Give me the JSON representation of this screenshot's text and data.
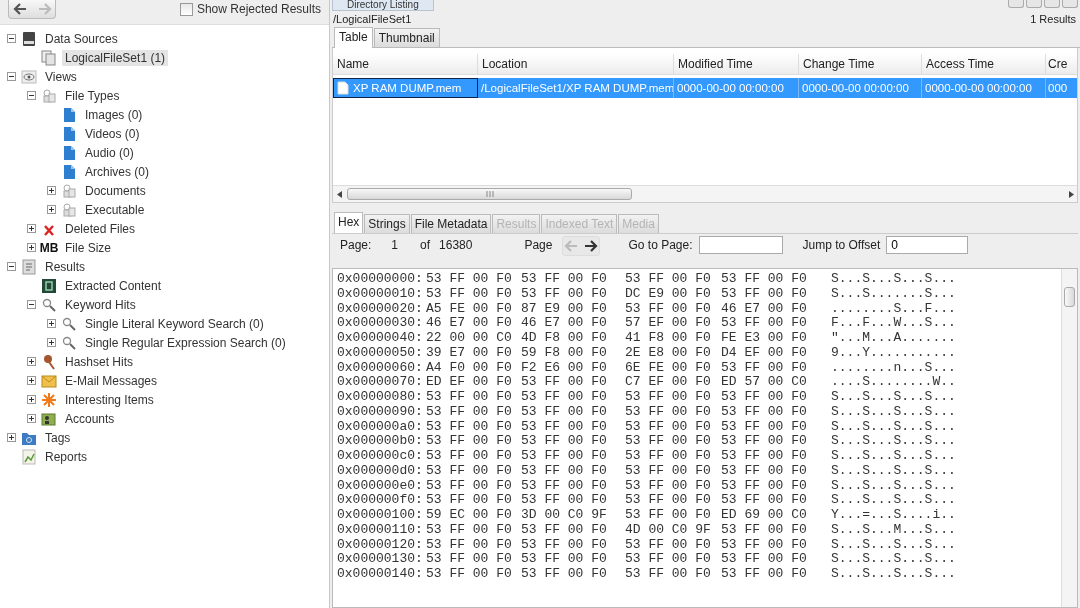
{
  "toolbar": {
    "nav_buttons": [
      {
        "kind": "back",
        "disabled": false
      },
      {
        "kind": "forward",
        "disabled": true
      }
    ],
    "show_rejected": {
      "label": "Show Rejected Results",
      "checked": false
    }
  },
  "tree": [
    {
      "label": "Data Sources",
      "kind": "drive",
      "expanded": true,
      "selected": false,
      "children": [
        {
          "label": "LogicalFileSet1 (1)",
          "kind": "files",
          "selected": true
        }
      ]
    },
    {
      "label": "Views",
      "kind": "eye",
      "expanded": true,
      "selected": false,
      "children": [
        {
          "label": "File Types",
          "kind": "filetypes",
          "expanded": true,
          "selected": false,
          "children": [
            {
              "label": "Images (0)",
              "kind": "doc",
              "selected": false
            },
            {
              "label": "Videos (0)",
              "kind": "doc",
              "selected": false
            },
            {
              "label": "Audio (0)",
              "kind": "doc",
              "selected": false
            },
            {
              "label": "Archives (0)",
              "kind": "doc",
              "selected": false
            },
            {
              "label": "Documents",
              "kind": "filetypes",
              "expanded": false,
              "selected": false
            },
            {
              "label": "Executable",
              "kind": "filetypes",
              "expanded": false,
              "selected": false
            }
          ]
        },
        {
          "label": "Deleted Files",
          "kind": "deleted",
          "expanded": false,
          "selected": false
        },
        {
          "label": "File Size",
          "kind": "size",
          "icon_text": "MB",
          "expanded": false,
          "selected": false
        }
      ]
    },
    {
      "label": "Results",
      "kind": "results",
      "expanded": true,
      "selected": false,
      "children": [
        {
          "label": "Extracted Content",
          "kind": "extracted",
          "selected": false
        },
        {
          "label": "Keyword Hits",
          "kind": "search",
          "expanded": true,
          "selected": false,
          "children": [
            {
              "label": "Single Literal Keyword Search (0)",
              "kind": "search",
              "expanded": false,
              "selected": false
            },
            {
              "label": "Single Regular Expression Search (0)",
              "kind": "search",
              "expanded": false,
              "selected": false
            }
          ]
        },
        {
          "label": "Hashset Hits",
          "kind": "pin",
          "expanded": false,
          "selected": false
        },
        {
          "label": "E-Mail Messages",
          "kind": "mail",
          "expanded": false,
          "selected": false
        },
        {
          "label": "Interesting Items",
          "kind": "star",
          "expanded": false,
          "selected": false
        },
        {
          "label": "Accounts",
          "kind": "accounts",
          "expanded": false,
          "selected": false
        }
      ]
    },
    {
      "label": "Tags",
      "kind": "tags",
      "expanded": false,
      "selected": false
    },
    {
      "label": "Reports",
      "kind": "reports",
      "selected": false
    }
  ],
  "listing": {
    "tab": "Directory Listing",
    "path": "/LogicalFileSet1",
    "result_count": "1 Results",
    "tabs": [
      {
        "label": "Table",
        "selected": true
      },
      {
        "label": "Thumbnail",
        "selected": false
      }
    ],
    "columns": [
      "Name",
      "Location",
      "Modified Time",
      "Change Time",
      "Access Time",
      "Cre"
    ],
    "rows": [
      {
        "cells": [
          "XP RAM DUMP.mem",
          "/LogicalFileSet1/XP RAM DUMP.mem",
          "0000-00-00 00:00:00",
          "0000-00-00 00:00:00",
          "0000-00-00 00:00:00",
          "000"
        ],
        "selected": true
      }
    ]
  },
  "viewer": {
    "tabs": [
      {
        "label": "Hex",
        "selected": true,
        "disabled": false
      },
      {
        "label": "Strings",
        "selected": false,
        "disabled": false
      },
      {
        "label": "File Metadata",
        "selected": false,
        "disabled": false
      },
      {
        "label": "Results",
        "selected": false,
        "disabled": true
      },
      {
        "label": "Indexed Text",
        "selected": false,
        "disabled": true
      },
      {
        "label": "Media",
        "selected": false,
        "disabled": true
      }
    ],
    "pager": {
      "page_label": "Page:",
      "page": "1",
      "of_label": "of",
      "total": "16380",
      "nav_label": "Page",
      "nav_buttons": [
        {
          "kind": "prev",
          "disabled": true
        },
        {
          "kind": "next",
          "disabled": false
        }
      ],
      "goto_label": "Go to Page:",
      "jump_label": "Jump to Offset",
      "jump_value": "0"
    },
    "hex_rows": [
      {
        "offset": "0x00000000:",
        "groups": [
          "53 FF 00 F0",
          "53 FF 00 F0",
          "53 FF 00 F0",
          "53 FF 00 F0"
        ],
        "ascii": "S...S...S...S..."
      },
      {
        "offset": "0x00000010:",
        "groups": [
          "53 FF 00 F0",
          "53 FF 00 F0",
          "DC E9 00 F0",
          "53 FF 00 F0"
        ],
        "ascii": "S...S.......S..."
      },
      {
        "offset": "0x00000020:",
        "groups": [
          "A5 FE 00 F0",
          "87 E9 00 F0",
          "53 FF 00 F0",
          "46 E7 00 F0"
        ],
        "ascii": "........S...F..."
      },
      {
        "offset": "0x00000030:",
        "groups": [
          "46 E7 00 F0",
          "46 E7 00 F0",
          "57 EF 00 F0",
          "53 FF 00 F0"
        ],
        "ascii": "F...F...W...S..."
      },
      {
        "offset": "0x00000040:",
        "groups": [
          "22 00 00 C0",
          "4D F8 00 F0",
          "41 F8 00 F0",
          "FE E3 00 F0"
        ],
        "ascii": "\"...M...A......."
      },
      {
        "offset": "0x00000050:",
        "groups": [
          "39 E7 00 F0",
          "59 F8 00 F0",
          "2E E8 00 F0",
          "D4 EF 00 F0"
        ],
        "ascii": "9...Y..........."
      },
      {
        "offset": "0x00000060:",
        "groups": [
          "A4 F0 00 F0",
          "F2 E6 00 F0",
          "6E FE 00 F0",
          "53 FF 00 F0"
        ],
        "ascii": "........n...S..."
      },
      {
        "offset": "0x00000070:",
        "groups": [
          "ED EF 00 F0",
          "53 FF 00 F0",
          "C7 EF 00 F0",
          "ED 57 00 C0"
        ],
        "ascii": "....S........W.."
      },
      {
        "offset": "0x00000080:",
        "groups": [
          "53 FF 00 F0",
          "53 FF 00 F0",
          "53 FF 00 F0",
          "53 FF 00 F0"
        ],
        "ascii": "S...S...S...S..."
      },
      {
        "offset": "0x00000090:",
        "groups": [
          "53 FF 00 F0",
          "53 FF 00 F0",
          "53 FF 00 F0",
          "53 FF 00 F0"
        ],
        "ascii": "S...S...S...S..."
      },
      {
        "offset": "0x000000a0:",
        "groups": [
          "53 FF 00 F0",
          "53 FF 00 F0",
          "53 FF 00 F0",
          "53 FF 00 F0"
        ],
        "ascii": "S...S...S...S..."
      },
      {
        "offset": "0x000000b0:",
        "groups": [
          "53 FF 00 F0",
          "53 FF 00 F0",
          "53 FF 00 F0",
          "53 FF 00 F0"
        ],
        "ascii": "S...S...S...S..."
      },
      {
        "offset": "0x000000c0:",
        "groups": [
          "53 FF 00 F0",
          "53 FF 00 F0",
          "53 FF 00 F0",
          "53 FF 00 F0"
        ],
        "ascii": "S...S...S...S..."
      },
      {
        "offset": "0x000000d0:",
        "groups": [
          "53 FF 00 F0",
          "53 FF 00 F0",
          "53 FF 00 F0",
          "53 FF 00 F0"
        ],
        "ascii": "S...S...S...S..."
      },
      {
        "offset": "0x000000e0:",
        "groups": [
          "53 FF 00 F0",
          "53 FF 00 F0",
          "53 FF 00 F0",
          "53 FF 00 F0"
        ],
        "ascii": "S...S...S...S..."
      },
      {
        "offset": "0x000000f0:",
        "groups": [
          "53 FF 00 F0",
          "53 FF 00 F0",
          "53 FF 00 F0",
          "53 FF 00 F0"
        ],
        "ascii": "S...S...S...S..."
      },
      {
        "offset": "0x00000100:",
        "groups": [
          "59 EC 00 F0",
          "3D 00 C0 9F",
          "53 FF 00 F0",
          "ED 69 00 C0"
        ],
        "ascii": "Y...=...S....i.."
      },
      {
        "offset": "0x00000110:",
        "groups": [
          "53 FF 00 F0",
          "53 FF 00 F0",
          "4D 00 C0 9F",
          "53 FF 00 F0"
        ],
        "ascii": "S...S...M...S..."
      },
      {
        "offset": "0x00000120:",
        "groups": [
          "53 FF 00 F0",
          "53 FF 00 F0",
          "53 FF 00 F0",
          "53 FF 00 F0"
        ],
        "ascii": "S...S...S...S..."
      },
      {
        "offset": "0x00000130:",
        "groups": [
          "53 FF 00 F0",
          "53 FF 00 F0",
          "53 FF 00 F0",
          "53 FF 00 F0"
        ],
        "ascii": "S...S...S...S..."
      },
      {
        "offset": "0x00000140:",
        "groups": [
          "53 FF 00 F0",
          "53 FF 00 F0",
          "53 FF 00 F0",
          "53 FF 00 F0"
        ],
        "ascii": "S...S...S...S..."
      }
    ]
  }
}
